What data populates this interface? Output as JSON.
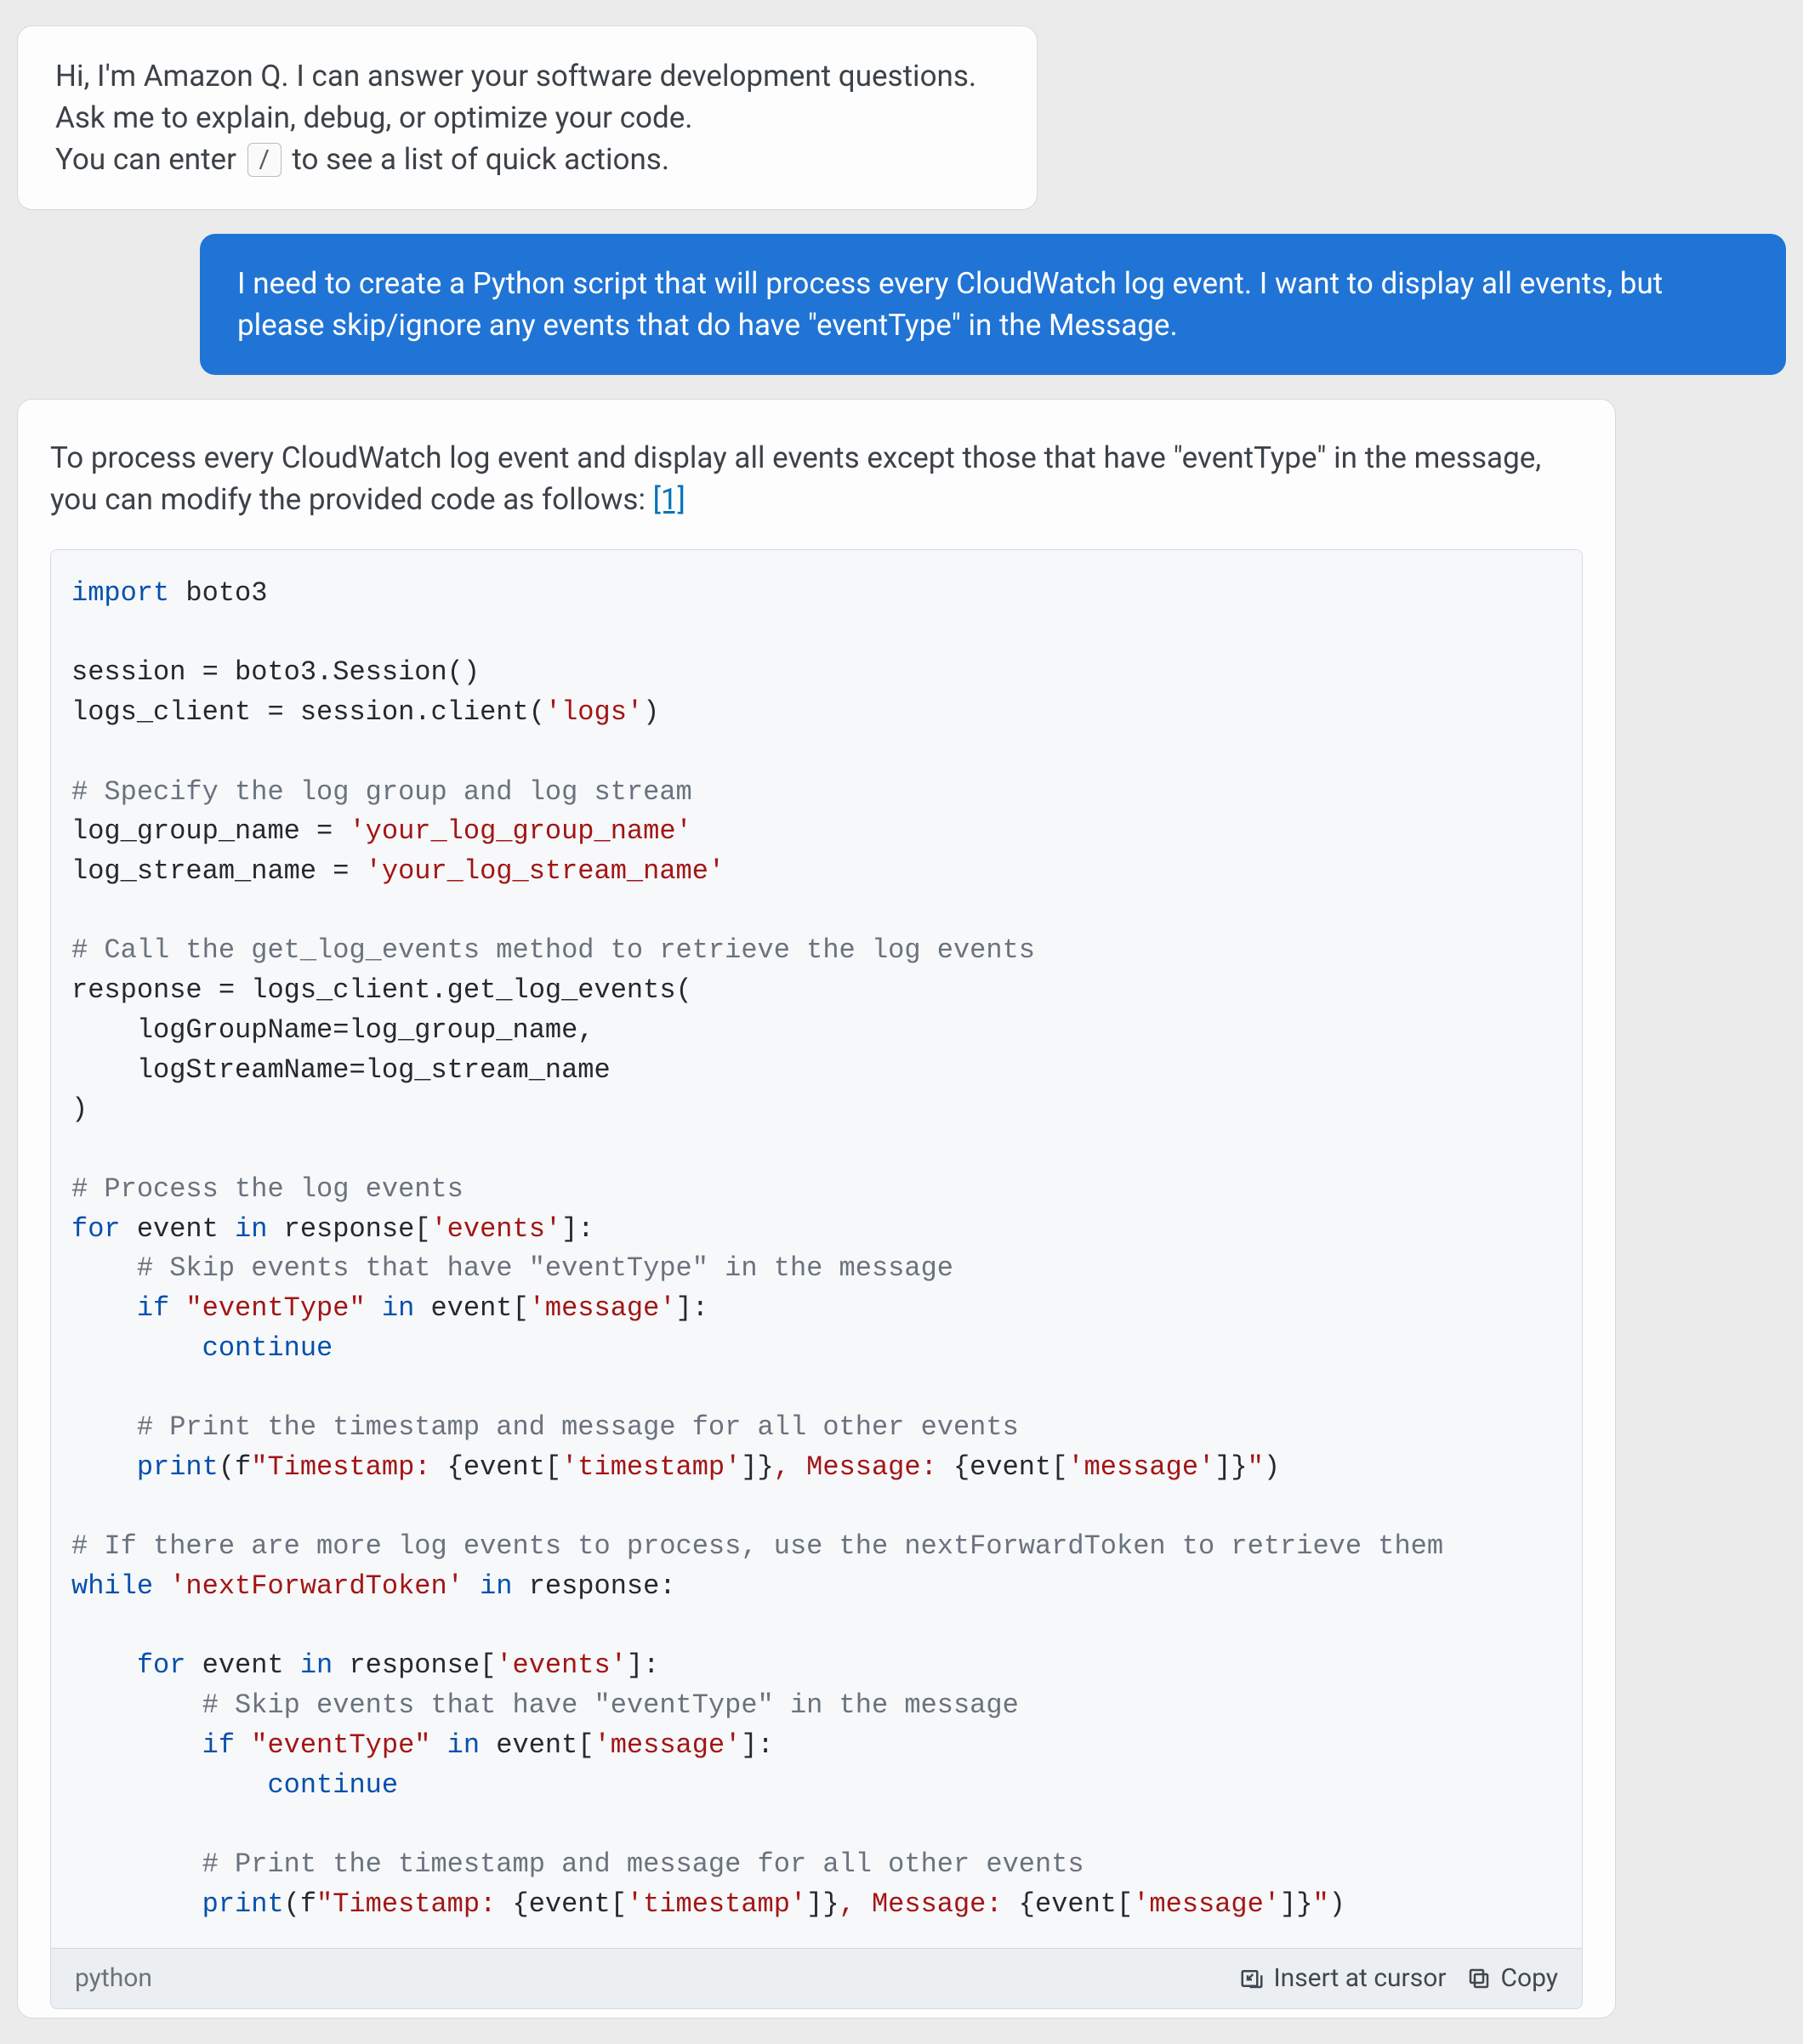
{
  "intro": {
    "line1": "Hi, I'm Amazon Q. I can answer your software development questions.",
    "line2": "Ask me to explain, debug, or optimize your code.",
    "line3a": "You can enter",
    "slash_key": "/",
    "line3b": "to see a list of quick actions."
  },
  "user_message": "I need to create a Python script that will process every CloudWatch log event. I want to display all events, but please skip/ignore any events that do have \"eventType\" in the Message.",
  "answer_intro_a": "To process every CloudWatch log event and display all events except those that have \"eventType\" in the message, you can modify the provided code as follows: ",
  "citation_label": "[1]",
  "code": {
    "l1_import": "import",
    "l1_boto3": " boto3",
    "l3": "session = boto3.Session()",
    "l4a": "logs_client = session.client(",
    "l4b": "'logs'",
    "l4c": ")",
    "l6": "# Specify the log group and log stream",
    "l7a": "log_group_name = ",
    "l7b": "'your_log_group_name'",
    "l8a": "log_stream_name = ",
    "l8b": "'your_log_stream_name'",
    "l10": "# Call the get_log_events method to retrieve the log events",
    "l11": "response = logs_client.get_log_events(",
    "l12": "    logGroupName=log_group_name,",
    "l13": "    logStreamName=log_stream_name",
    "l14": ")",
    "l16": "# Process the log events",
    "l17_for": "for",
    "l17_a": " event ",
    "l17_in": "in",
    "l17_b": " response[",
    "l17_c": "'events'",
    "l17_d": "]:",
    "l18": "    # Skip events that have \"eventType\" in the message",
    "l19_pad": "    ",
    "l19_if": "if",
    "l19_sp": " ",
    "l19_str": "\"eventType\"",
    "l19_in": "in",
    "l19_b": " event[",
    "l19_c": "'message'",
    "l19_d": "]:",
    "l20_pad": "        ",
    "l20_cont": "continue",
    "l22": "    # Print the timestamp and message for all other events",
    "l23_pad": "    ",
    "l23_print": "print",
    "l23_a": "(f",
    "l23_s1": "\"Timestamp: ",
    "l23_b": "{event[",
    "l23_s2": "'timestamp'",
    "l23_c": "]}",
    "l23_s3": ", Message: ",
    "l23_d": "{event[",
    "l23_s4": "'message'",
    "l23_e": "]}",
    "l23_s5": "\"",
    "l23_f": ")",
    "l25": "# If there are more log events to process, use the nextForwardToken to retrieve them",
    "l26_while": "while",
    "l26_sp": " ",
    "l26_str": "'nextForwardToken'",
    "l26_in": "in",
    "l26_b": " response:",
    "l28_pad": "    ",
    "l28_for": "for",
    "l28_a": " event ",
    "l28_in": "in",
    "l28_b": " response[",
    "l28_c": "'events'",
    "l28_d": "]:",
    "l29": "        # Skip events that have \"eventType\" in the message",
    "l30_pad": "        ",
    "l30_if": "if",
    "l30_sp": " ",
    "l30_str": "\"eventType\"",
    "l30_in": "in",
    "l30_b": " event[",
    "l30_c": "'message'",
    "l30_d": "]:",
    "l31_pad": "            ",
    "l31_cont": "continue",
    "l33": "        # Print the timestamp and message for all other events",
    "l34_pad": "        ",
    "l34_print": "print",
    "l34_a": "(f",
    "l34_s1": "\"Timestamp: ",
    "l34_b": "{event[",
    "l34_s2": "'timestamp'",
    "l34_c": "]}",
    "l34_s3": ", Message: ",
    "l34_d": "{event[",
    "l34_s4": "'message'",
    "l34_e": "]}",
    "l34_s5": "\"",
    "l34_f": ")"
  },
  "footer": {
    "language": "python",
    "insert_label": "Insert at cursor",
    "copy_label": "Copy"
  }
}
